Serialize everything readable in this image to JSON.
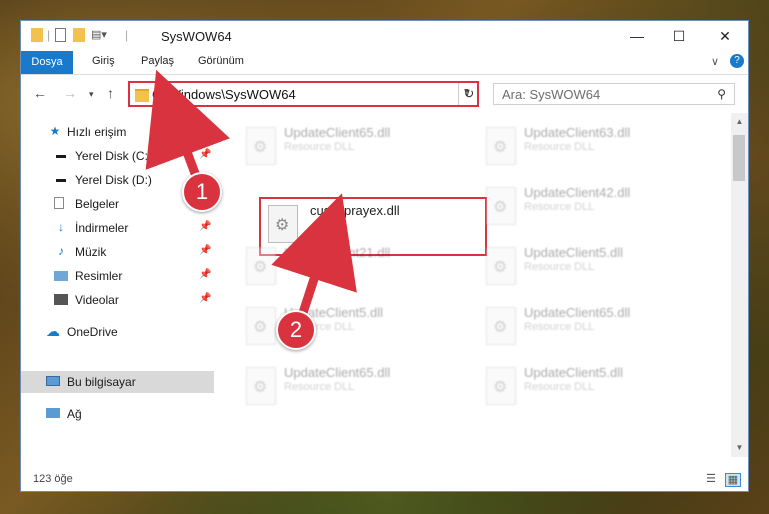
{
  "window": {
    "title": "SysWOW64",
    "controls": {
      "minimize": "—",
      "maximize": "☐",
      "close": "✕"
    }
  },
  "ribbon": {
    "tabs": [
      "Dosya",
      "Giriş",
      "Paylaş",
      "Görünüm"
    ],
    "collapse": "∨",
    "help": "?"
  },
  "nav": {
    "address": "C:\\Windows\\SysWOW64",
    "search_placeholder": "Ara: SysWOW64"
  },
  "sidebar": {
    "items": [
      {
        "label": "Hızlı erişim",
        "icon": "star-icon",
        "pinned": false
      },
      {
        "label": "Yerel Disk (C:)",
        "icon": "drive-icon",
        "pinned": true
      },
      {
        "label": "Yerel Disk (D:)",
        "icon": "drive-icon",
        "pinned": false
      },
      {
        "label": "Belgeler",
        "icon": "documents-icon",
        "pinned": true
      },
      {
        "label": "İndirmeler",
        "icon": "download-icon",
        "pinned": true
      },
      {
        "label": "Müzik",
        "icon": "music-icon",
        "pinned": true
      },
      {
        "label": "Resimler",
        "icon": "pictures-icon",
        "pinned": true
      },
      {
        "label": "Videolar",
        "icon": "videos-icon",
        "pinned": true
      },
      {
        "label": "OneDrive",
        "icon": "cloud-icon",
        "pinned": false
      },
      {
        "label": "Bu bilgisayar",
        "icon": "computer-icon",
        "pinned": false,
        "selected": true
      },
      {
        "label": "Ağ",
        "icon": "network-icon",
        "pinned": false
      }
    ]
  },
  "files": [
    {
      "name": "UpdateClient65.dll",
      "type": "Resource DLL"
    },
    {
      "name": "UpdateClient63.dll",
      "type": "Resource DLL"
    },
    {
      "name": "cus_sprayex.dll",
      "type": ""
    },
    {
      "name": "UpdateClient42.dll",
      "type": "Resource DLL"
    },
    {
      "name": "UpdateClient21.dll",
      "type": "Resource DLL"
    },
    {
      "name": "UpdateClient5.dll",
      "type": "Resource DLL"
    },
    {
      "name": "UpdateClient5.dll",
      "type": "Resource DLL"
    },
    {
      "name": "UpdateClient65.dll",
      "type": "Resource DLL"
    },
    {
      "name": "UpdateClient65.dll",
      "type": "Resource DLL"
    },
    {
      "name": "UpdateClient5.dll",
      "type": "Resource DLL"
    }
  ],
  "status": {
    "count": "123 öğe"
  },
  "annotations": {
    "step1": "1",
    "step2": "2",
    "color": "#d9333f"
  }
}
